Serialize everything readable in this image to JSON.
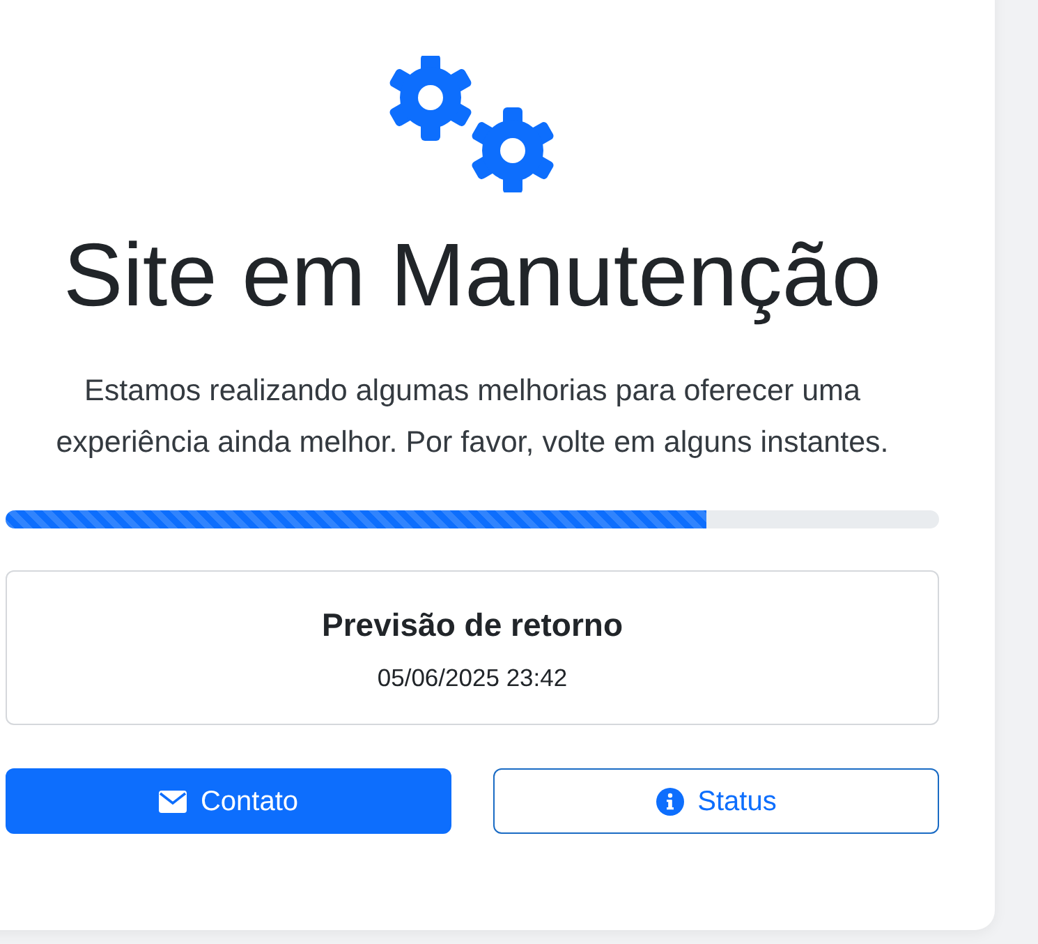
{
  "title": "Site em Manutenção",
  "message": "Estamos realizando algumas melhorias para oferecer uma experiência ainda melhor. Por favor, volte em alguns instantes.",
  "progress": {
    "level": 0.75,
    "striped": true
  },
  "forecast": {
    "label": "Previsão de retorno",
    "value": "05/06/2025 23:42"
  },
  "buttons": [
    {
      "label": "Contato",
      "kind": "primary"
    },
    {
      "label": "Status",
      "kind": "outline"
    }
  ]
}
